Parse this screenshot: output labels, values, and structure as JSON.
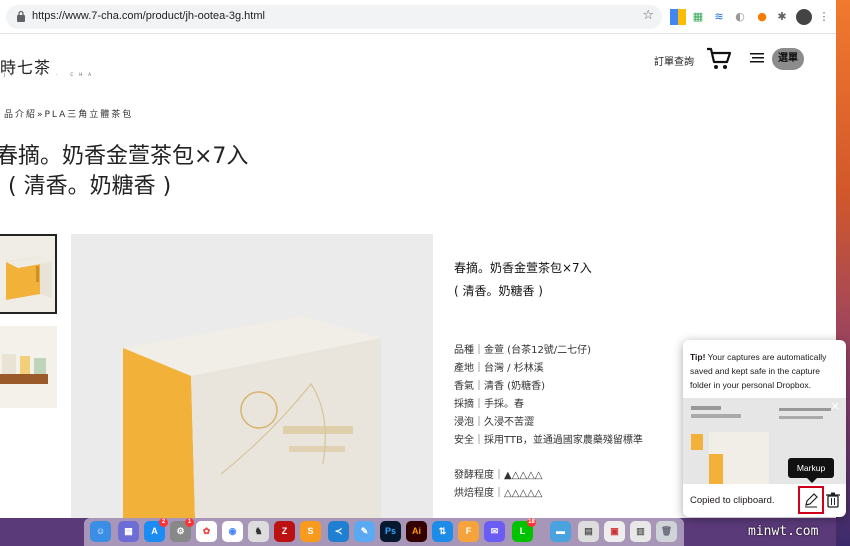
{
  "browser": {
    "url": "https://www.7-cha.com/product/jh-ootea-3g.html"
  },
  "site": {
    "logo": "時七茶",
    "logo_sub": "JI · T · CHA",
    "orders_label": "訂單查詢",
    "menu_label": "選單"
  },
  "page": {
    "breadcrumb": "品介紹»PLA三角立體茶包",
    "title_line1": "春摘。奶香金萱茶包×7入",
    "title_line2": "( 清香。奶糖香 )"
  },
  "description": {
    "title_line1": "春摘。奶香金萱茶包×7入",
    "title_line2": "( 清香。奶糖香 )",
    "specs": [
      "品種｜金萱 (台茶12號/二七仔)",
      "產地｜台灣 / 杉林溪",
      "香氣｜清香 (奶糖香)",
      "採摘｜手採。春",
      "浸泡｜久浸不苦澀",
      "安全｜採用TTB，並通過國家農藥殘留標準"
    ],
    "levels": [
      "發酵程度｜▲△△△△",
      "烘焙程度｜△△△△△"
    ]
  },
  "dropbox": {
    "tip_bold": "Tip!",
    "tip_text": " Your captures are automatically saved and kept safe in the capture folder in your personal Dropbox.",
    "status": "Copied to clipboard.",
    "markup_tooltip": "Markup"
  },
  "dock": {
    "badge_appstore": "2",
    "badge_settings": "1",
    "badge_line": "18"
  },
  "watermark": "minwt.com",
  "colors": {
    "accent_yellow": "#f2b23a",
    "highlight_red": "#d0021b",
    "menu_btn_bg": "#8c8c8c"
  }
}
